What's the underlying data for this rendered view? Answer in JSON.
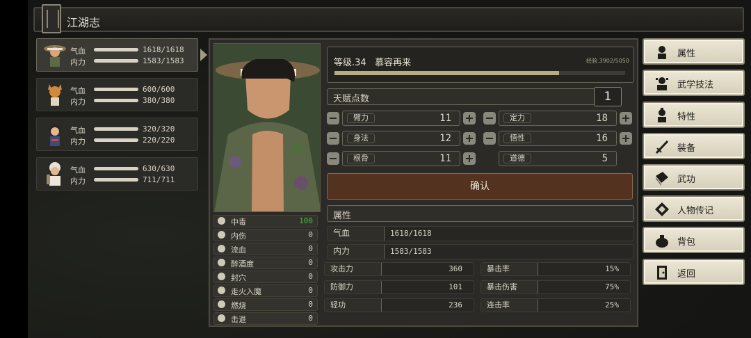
{
  "title": "江湖志",
  "party": [
    {
      "hp_label": "气血",
      "hp": "1618/1618",
      "mp_label": "内力",
      "mp": "1583/1583"
    },
    {
      "hp_label": "气血",
      "hp": "600/600",
      "mp_label": "内力",
      "mp": "380/380"
    },
    {
      "hp_label": "气血",
      "hp": "320/320",
      "mp_label": "内力",
      "mp": "220/220"
    },
    {
      "hp_label": "气血",
      "hp": "630/630",
      "mp_label": "内力",
      "mp": "711/711"
    }
  ],
  "status": [
    {
      "name": "中毒",
      "value": "100"
    },
    {
      "name": "内伤",
      "value": "0"
    },
    {
      "name": "流血",
      "value": "0"
    },
    {
      "name": "醉酒度",
      "value": "0"
    },
    {
      "name": "封穴",
      "value": "0"
    },
    {
      "name": "走火入魔",
      "value": "0"
    },
    {
      "name": "燃烧",
      "value": "0"
    },
    {
      "name": "击退",
      "value": "0"
    }
  ],
  "level": {
    "text": "等级.34",
    "name": "慕容再来",
    "exp": "经验.3902/5050",
    "exp_fraction": 0.773
  },
  "talent": {
    "label": "天赋点数",
    "value": "1"
  },
  "attributes": [
    {
      "name": "臂力",
      "value": "11"
    },
    {
      "name": "定力",
      "value": "18"
    },
    {
      "name": "身法",
      "value": "12"
    },
    {
      "name": "悟性",
      "value": "16"
    },
    {
      "name": "根骨",
      "value": "11"
    },
    {
      "name": "道德",
      "value": "5"
    }
  ],
  "confirm_label": "确认",
  "props_header": "属性",
  "hp_row": {
    "label": "气血",
    "value": "1618/1618"
  },
  "mp_row": {
    "label": "内力",
    "value": "1583/1583"
  },
  "combat": [
    {
      "label": "攻击力",
      "value": "360"
    },
    {
      "label": "暴击率",
      "value": "15%"
    },
    {
      "label": "防御力",
      "value": "101"
    },
    {
      "label": "暴击伤害",
      "value": "75%"
    },
    {
      "label": "轻功",
      "value": "236"
    },
    {
      "label": "连击率",
      "value": "25%"
    }
  ],
  "menu": [
    {
      "label": "属性",
      "icon": "person-icon"
    },
    {
      "label": "武学技法",
      "icon": "martial-icon"
    },
    {
      "label": "特性",
      "icon": "trait-icon"
    },
    {
      "label": "装备",
      "icon": "sword-icon"
    },
    {
      "label": "武功",
      "icon": "book-icon"
    },
    {
      "label": "人物传记",
      "icon": "scroll-icon"
    },
    {
      "label": "背包",
      "icon": "bag-icon"
    },
    {
      "label": "返回",
      "icon": "door-icon"
    }
  ],
  "colors": {
    "accent": "#53321f",
    "poison": "#3fbf3f",
    "panel": "#2b2a26",
    "menu": "#ece7d5"
  }
}
